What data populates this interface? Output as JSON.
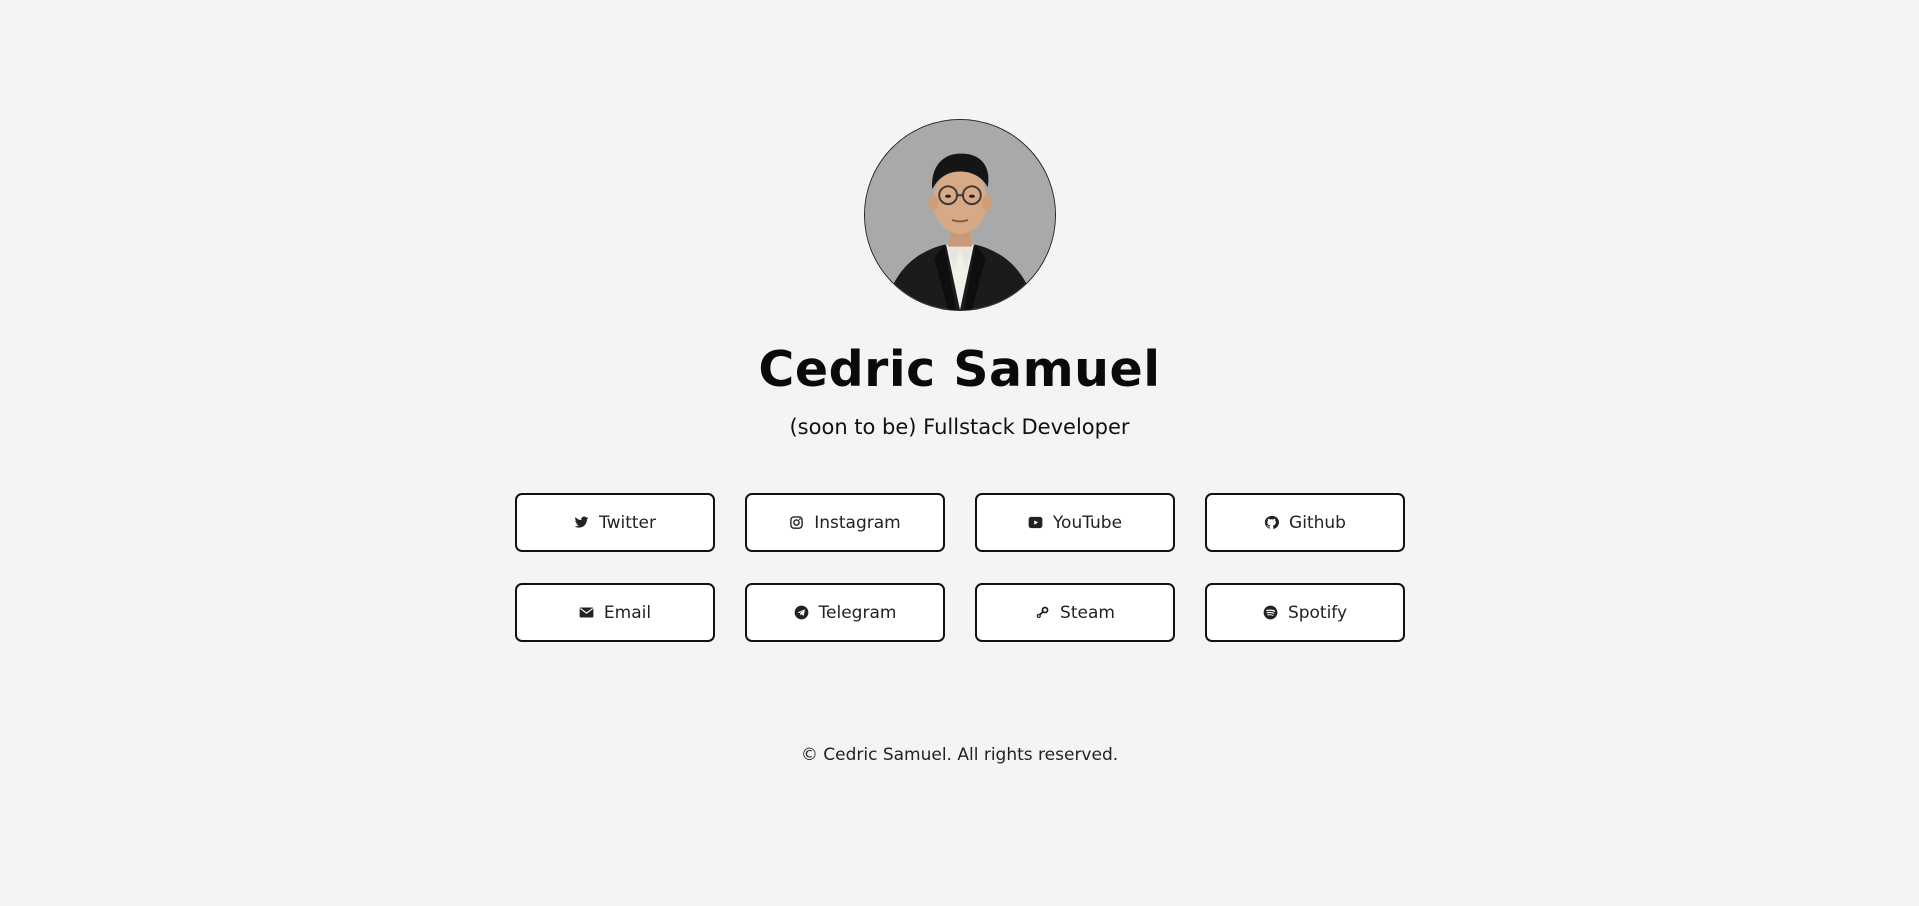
{
  "profile": {
    "avatar_alt": "Cedric Samuel",
    "name": "Cedric Samuel",
    "subtitle": "(soon to be) Fullstack Developer"
  },
  "links": [
    {
      "label": "Twitter",
      "icon": "twitter-icon"
    },
    {
      "label": "Instagram",
      "icon": "instagram-icon"
    },
    {
      "label": "YouTube",
      "icon": "youtube-icon"
    },
    {
      "label": "Github",
      "icon": "github-icon"
    },
    {
      "label": "Email",
      "icon": "envelope-icon"
    },
    {
      "label": "Telegram",
      "icon": "telegram-icon"
    },
    {
      "label": "Steam",
      "icon": "steam-icon"
    },
    {
      "label": "Spotify",
      "icon": "spotify-icon"
    }
  ],
  "footer": {
    "text": "© Cedric Samuel. All rights reserved."
  },
  "colors": {
    "background": "#f4f4f4",
    "button_border": "#111111",
    "button_fill": "#ffffff",
    "avatar_backdrop": "#a9a9a9"
  }
}
